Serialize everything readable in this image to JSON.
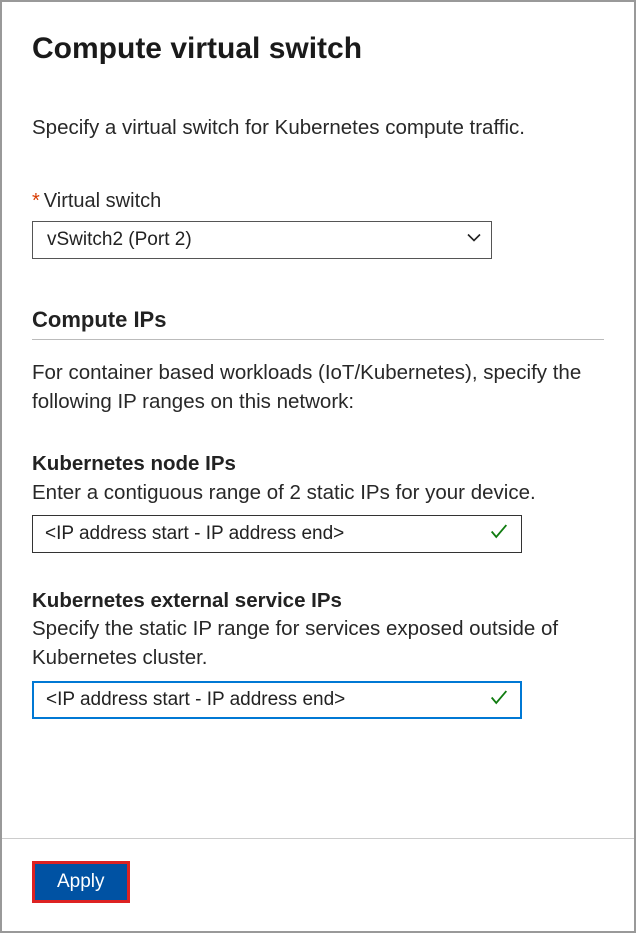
{
  "page": {
    "title": "Compute virtual switch",
    "subtitle": "Specify a virtual switch for Kubernetes compute traffic."
  },
  "virtual_switch": {
    "label": "Virtual switch",
    "selected": "vSwitch2 (Port 2)"
  },
  "compute_ips": {
    "header": "Compute IPs",
    "description": "For container based workloads (IoT/Kubernetes), specify the following IP ranges on this network:"
  },
  "node_ips": {
    "label": "Kubernetes node IPs",
    "description": "Enter a contiguous range of 2 static IPs for your device.",
    "placeholder": "<IP address start - IP address end>"
  },
  "service_ips": {
    "label": "Kubernetes external service IPs",
    "description": "Specify the static IP range for services exposed outside of Kubernetes cluster.",
    "placeholder": "<IP address start - IP address end>"
  },
  "footer": {
    "apply_label": "Apply"
  }
}
